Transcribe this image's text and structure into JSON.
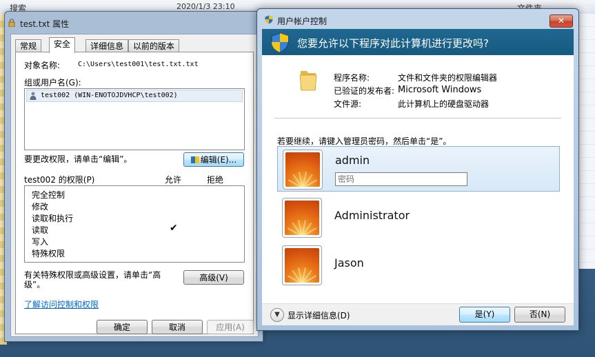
{
  "background": {
    "search_label": "搜索",
    "date_text": "2020/1/3 23:10",
    "column_text": "文件夹"
  },
  "properties_dialog": {
    "title": "test.txt 属性",
    "tabs": [
      "常规",
      "安全",
      "详细信息",
      "以前的版本"
    ],
    "active_tab": "安全",
    "object_name_label": "对象名称:",
    "object_name_value": "C:\\Users\\test001\\test.txt.txt",
    "group_label": "组或用户名(G):",
    "group_users": [
      "test002 (WIN-ENOTOJDVHCP\\test002)"
    ],
    "change_perm_hint": "要更改权限，请单击“编辑”。",
    "edit_button": "编辑(E)...",
    "perm_for_label": "test002 的权限(P)",
    "allow_col": "允许",
    "deny_col": "拒绝",
    "permissions": [
      {
        "name": "完全控制",
        "allow": ""
      },
      {
        "name": "修改",
        "allow": ""
      },
      {
        "name": "读取和执行",
        "allow": ""
      },
      {
        "name": "读取",
        "allow": "✔"
      },
      {
        "name": "写入",
        "allow": ""
      },
      {
        "name": "特殊权限",
        "allow": ""
      }
    ],
    "special_hint_line1": "有关特殊权限或高级设置，请单击“高",
    "special_hint_line2": "级”。",
    "advanced_button": "高级(V)",
    "learn_link": "了解访问控制和权限",
    "ok_button": "确定",
    "cancel_button": "取消",
    "apply_button": "应用(A)"
  },
  "uac_dialog": {
    "title": "用户帐户控制",
    "close_label": "✕",
    "question": "您要允许以下程序对此计算机进行更改吗?",
    "program_name_label": "程序名称:",
    "program_name_value": "文件和文件夹的权限编辑器",
    "publisher_label": "已验证的发布者:",
    "publisher_value": "Microsoft Windows",
    "source_label": "文件源:",
    "source_value": "此计算机上的硬盘驱动器",
    "prompt": "若要继续，请键入管理员密码，然后单击“是”。",
    "accounts": [
      {
        "name": "admin",
        "selected": true
      },
      {
        "name": "Administrator",
        "selected": false
      },
      {
        "name": "Jason",
        "selected": false
      }
    ],
    "password_placeholder": "密码",
    "password_value": "",
    "details_label": "显示详细信息(D)",
    "yes_button": "是(Y)",
    "no_button": "否(N)"
  },
  "colors": {
    "uac_header": "#1f6891",
    "link": "#0066cc",
    "close_button": "#c7402a"
  }
}
